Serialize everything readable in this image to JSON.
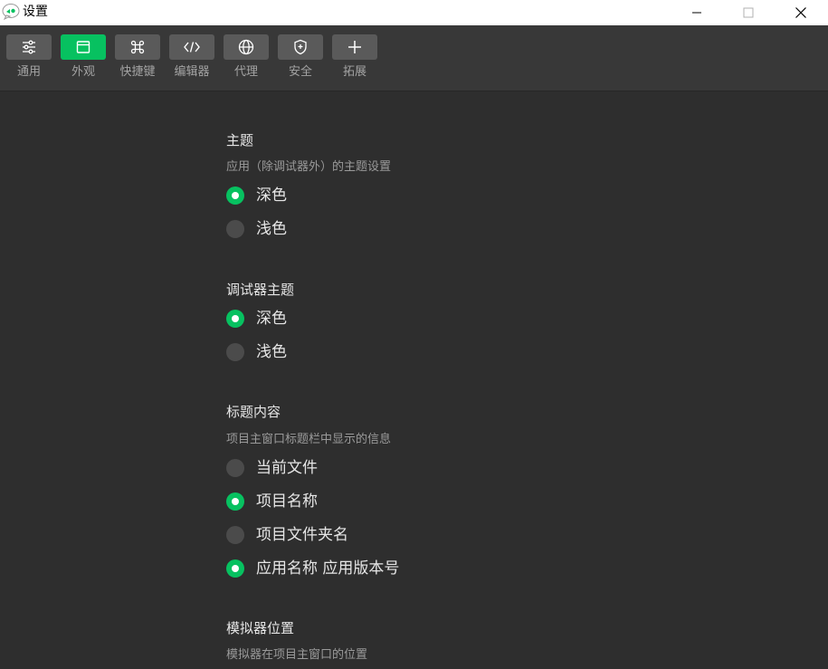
{
  "window": {
    "title": "设置"
  },
  "colors": {
    "accent": "#07c160",
    "background": "#2e2e2e",
    "toolbar": "#383838",
    "button": "#5a5a5a"
  },
  "toolbar": {
    "items": [
      {
        "label": "通用",
        "icon": "sliders-icon",
        "active": false
      },
      {
        "label": "外观",
        "icon": "window-icon",
        "active": true
      },
      {
        "label": "快捷键",
        "icon": "command-key-icon",
        "active": false
      },
      {
        "label": "编辑器",
        "icon": "code-icon",
        "active": false
      },
      {
        "label": "代理",
        "icon": "globe-icon",
        "active": false
      },
      {
        "label": "安全",
        "icon": "shield-icon",
        "active": false
      },
      {
        "label": "拓展",
        "icon": "plus-icon",
        "active": false
      }
    ]
  },
  "sections": {
    "theme": {
      "title": "主题",
      "desc": "应用（除调试器外）的主题设置",
      "options": [
        {
          "label": "深色",
          "selected": true
        },
        {
          "label": "浅色",
          "selected": false
        }
      ]
    },
    "debugger_theme": {
      "title": "调试器主题",
      "options": [
        {
          "label": "深色",
          "selected": true
        },
        {
          "label": "浅色",
          "selected": false
        }
      ]
    },
    "title_content": {
      "title": "标题内容",
      "desc": "项目主窗口标题栏中显示的信息",
      "options": [
        {
          "label": "当前文件",
          "selected": false
        },
        {
          "label": "项目名称",
          "selected": true
        },
        {
          "label": "项目文件夹名",
          "selected": false
        },
        {
          "label": "应用名称 应用版本号",
          "selected": true
        }
      ]
    },
    "simulator_position": {
      "title": "模拟器位置",
      "desc": "模拟器在项目主窗口的位置"
    }
  }
}
